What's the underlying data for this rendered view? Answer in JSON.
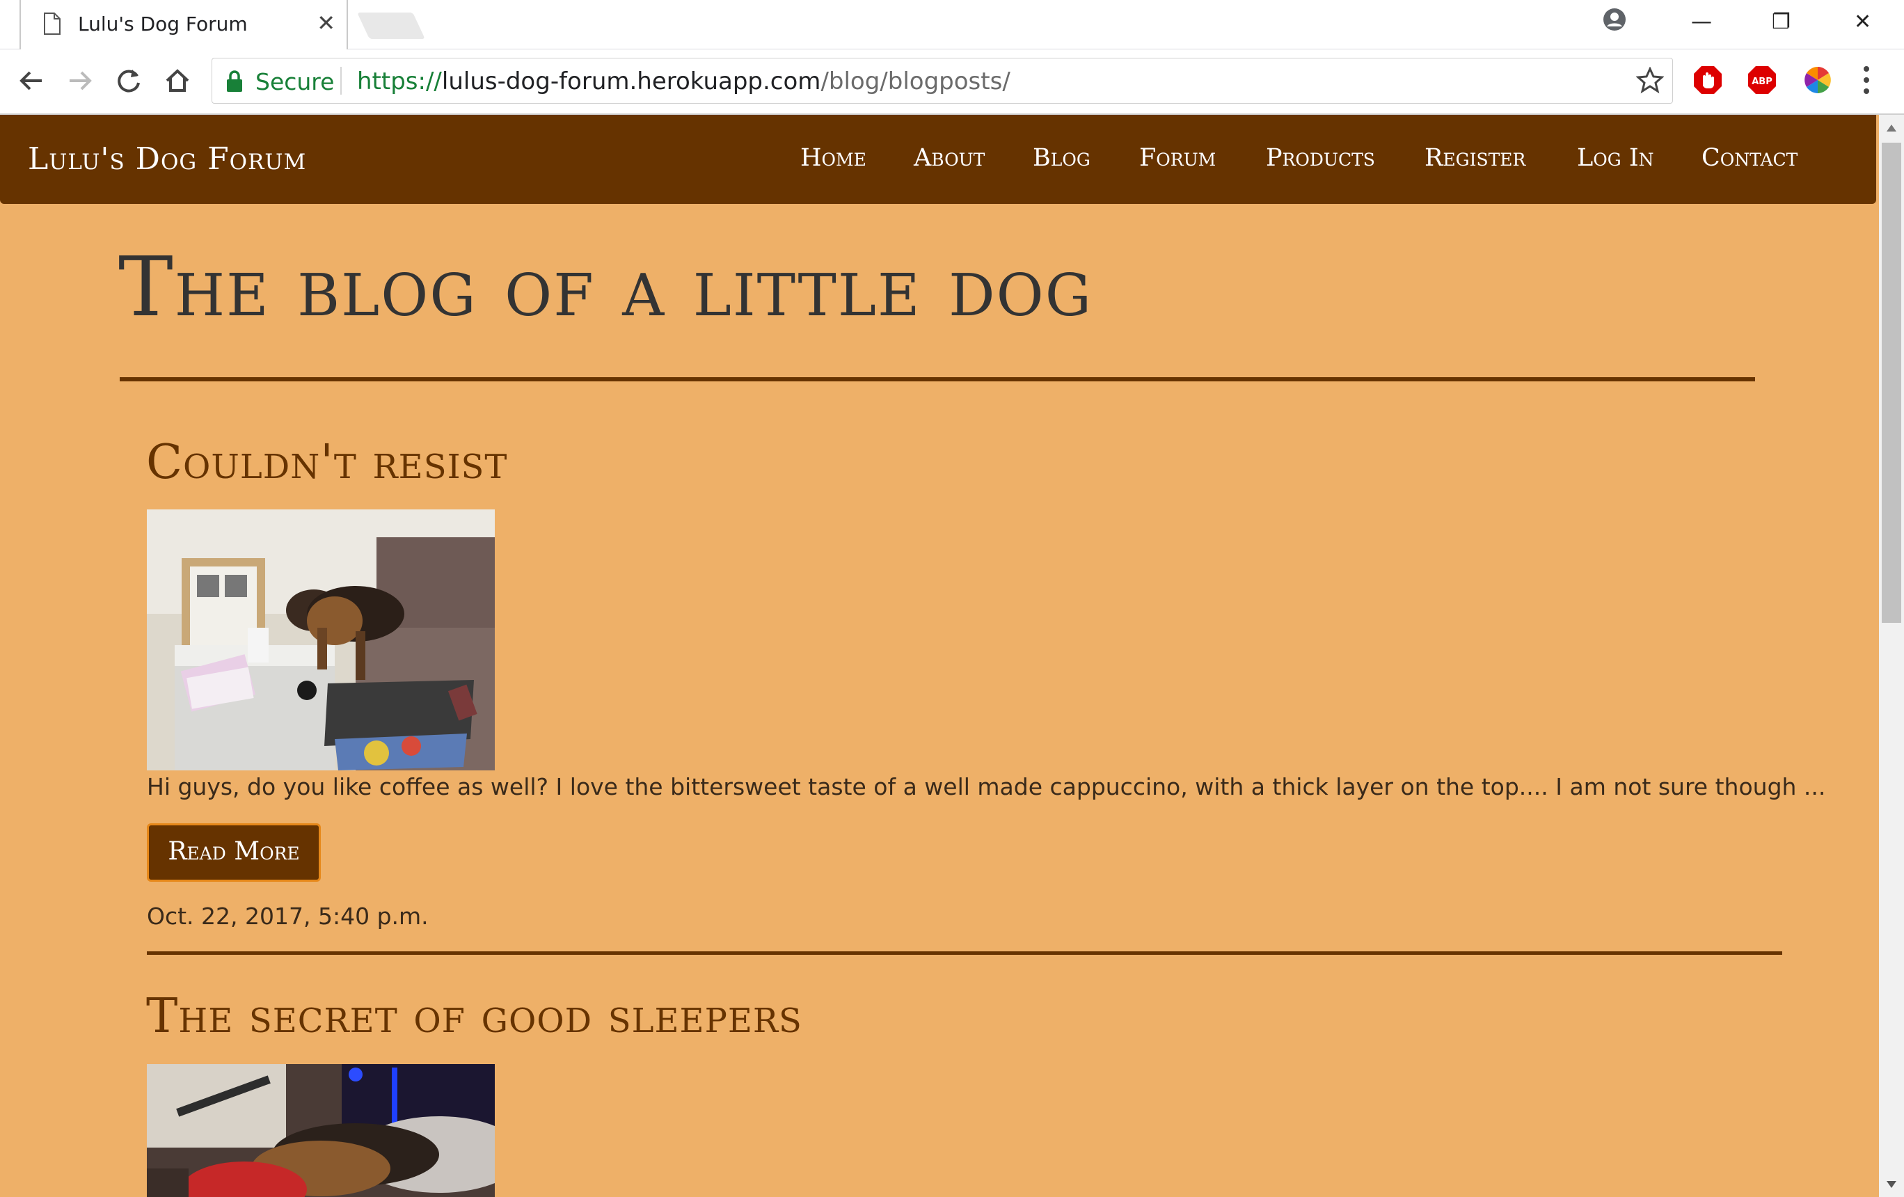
{
  "browser": {
    "tab_title": "Lulu's Dog Forum",
    "tab_close": "✕",
    "secure_label": "Secure",
    "url_scheme": "https://",
    "url_host": "lulus-dog-forum.herokuapp.com",
    "url_path": "/blog/blogposts/",
    "window_controls": {
      "minimize": "—",
      "restore": "❐",
      "close": "✕"
    },
    "extensions": [
      "stop-icon",
      "adblock-icon",
      "color-wheel-icon"
    ],
    "adblock_label": "ABP"
  },
  "site": {
    "brand": "Lulu's Dog Forum",
    "nav": [
      "Home",
      "About",
      "Blog",
      "Forum",
      "Products",
      "Register",
      "Log In",
      "Contact"
    ]
  },
  "page": {
    "title": "The blog of a little dog"
  },
  "posts": [
    {
      "title": "Couldn't resist",
      "excerpt": "Hi guys, do you like coffee as well? I love the bittersweet taste of a well made cappuccino, with a thick layer on the top.... I am not sure though ...",
      "read_more": "Read More",
      "date": "Oct. 22, 2017, 5:40 p.m."
    },
    {
      "title": "The secret of good sleepers"
    }
  ],
  "colors": {
    "page_bg": "#eeb068",
    "navbar_bg": "#663300",
    "accent_border": "#e6881a",
    "post_title": "#663300",
    "page_title": "#333333",
    "secure_green": "#188038"
  }
}
